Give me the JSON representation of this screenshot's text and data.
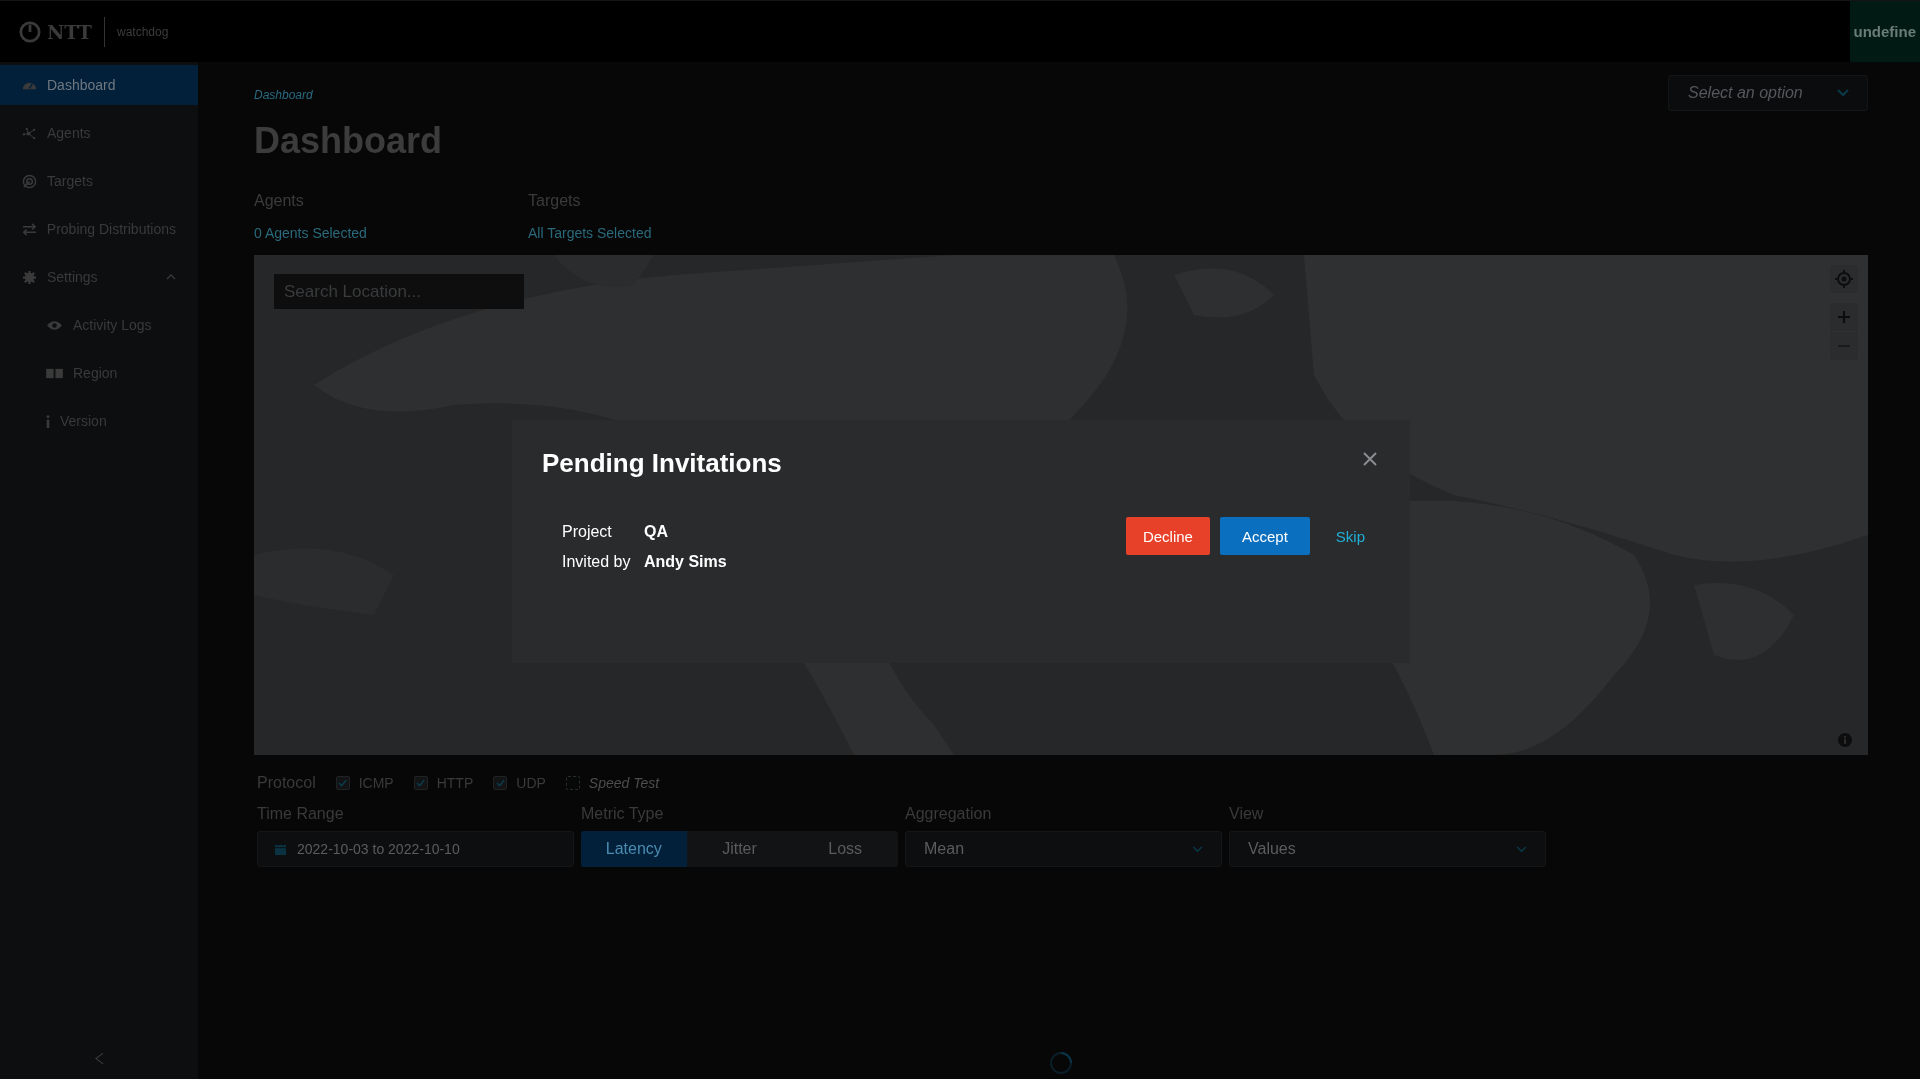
{
  "header": {
    "brand": "NTT",
    "product": "watchdog",
    "user_badge": "undefine"
  },
  "sidebar": {
    "items": [
      {
        "label": "Dashboard",
        "selected": true
      },
      {
        "label": "Agents",
        "selected": false
      },
      {
        "label": "Targets",
        "selected": false
      },
      {
        "label": "Probing Distributions",
        "selected": false
      },
      {
        "label": "Settings",
        "selected": false,
        "expanded": true,
        "children": [
          {
            "label": "Activity Logs",
            "selected": false
          },
          {
            "label": "Region",
            "selected": false
          },
          {
            "label": "Version",
            "selected": false
          }
        ]
      }
    ]
  },
  "breadcrumb": "Dashboard",
  "title": "Dashboard",
  "project_select": {
    "placeholder": "Select an option"
  },
  "filters": [
    {
      "label": "Agents",
      "value": "0 Agents Selected"
    },
    {
      "label": "Targets",
      "value": "All Targets Selected"
    }
  ],
  "map": {
    "search": {
      "placeholder": "Search Location..."
    }
  },
  "protocol": {
    "label": "Protocol",
    "options": [
      {
        "label": "ICMP",
        "checked": true,
        "disabled": false
      },
      {
        "label": "HTTP",
        "checked": true,
        "disabled": false
      },
      {
        "label": "UDP",
        "checked": true,
        "disabled": false
      },
      {
        "label": "Speed Test",
        "checked": false,
        "disabled": true
      }
    ]
  },
  "time_range": {
    "label": "Time Range",
    "value": "2022-10-03 to 2022-10-10"
  },
  "metric_type": {
    "label": "Metric Type",
    "options": [
      {
        "label": "Latency",
        "selected": true
      },
      {
        "label": "Jitter",
        "selected": false
      },
      {
        "label": "Loss",
        "selected": false
      }
    ]
  },
  "aggregation": {
    "label": "Aggregation",
    "value": "Mean"
  },
  "view": {
    "label": "View",
    "value": "Values"
  },
  "modal": {
    "title": "Pending Invitations",
    "fields": [
      {
        "label": "Project",
        "value": "QA"
      },
      {
        "label": "Invited by",
        "value": "Andy Sims"
      }
    ],
    "buttons": [
      {
        "label": "Decline",
        "kind": "danger"
      },
      {
        "label": "Accept",
        "kind": "primary"
      },
      {
        "label": "Skip",
        "kind": "link"
      }
    ]
  }
}
